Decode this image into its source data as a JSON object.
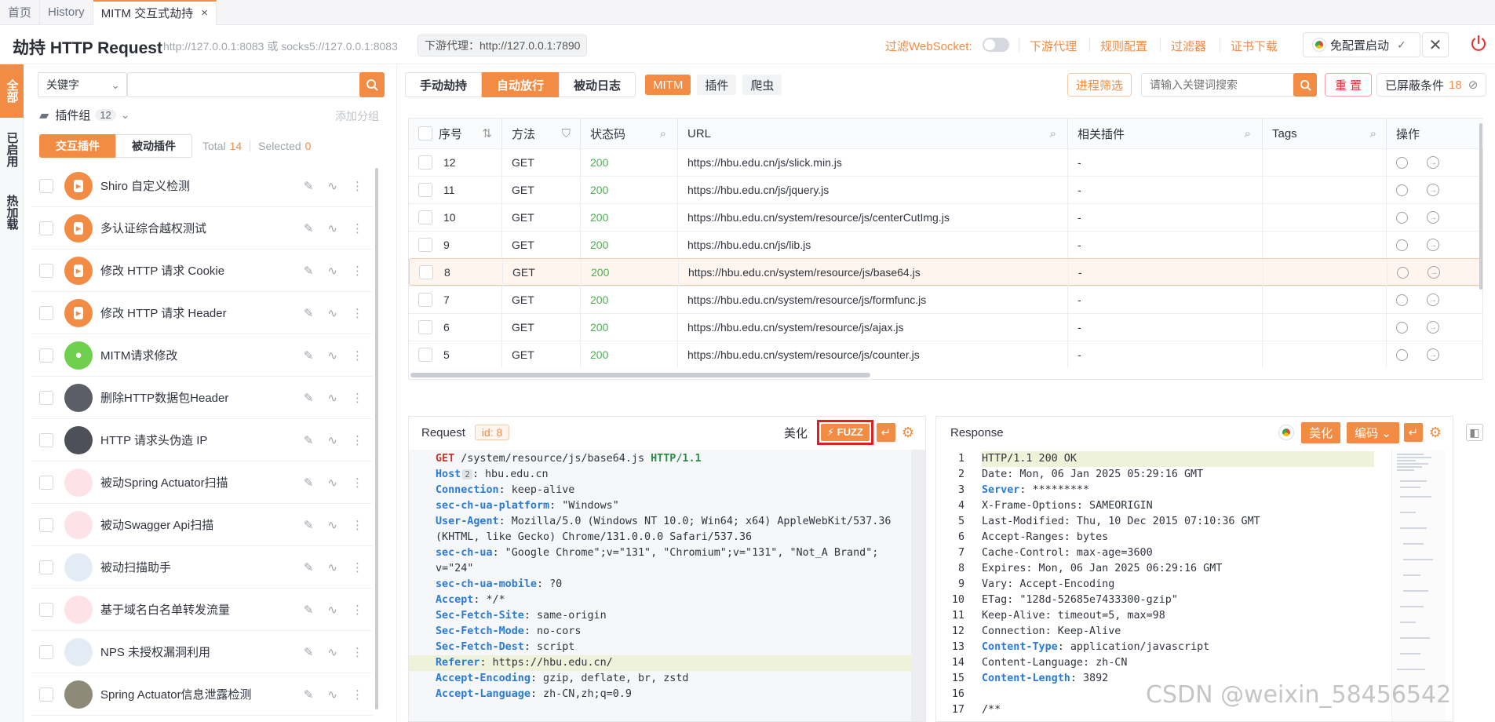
{
  "tabs": [
    {
      "label": "首页"
    },
    {
      "label": "History"
    },
    {
      "label": "MITM 交互式劫持",
      "close": "×"
    }
  ],
  "header": {
    "title": "劫持 HTTP Request",
    "listen": "http://127.0.0.1:8083 或 socks5://127.0.0.1:8083",
    "downstream": "下游代理：http://127.0.0.1:7890",
    "filter_ws": "过滤WebSocket:",
    "links": [
      "下游代理",
      "规则配置",
      "过滤器",
      "证书下载"
    ],
    "launch": "免配置启动"
  },
  "vtabs": [
    "全部",
    "已启用",
    "热加载"
  ],
  "left": {
    "keyword_select": "关键字",
    "plugin_group": "插件组",
    "plugin_group_count": "12",
    "add_group": "添加分组",
    "seg": [
      "交互插件",
      "被动插件"
    ],
    "total_label": "Total",
    "total": "14",
    "selected_label": "Selected",
    "selected": "0",
    "plugins": [
      "Shiro 自定义检测",
      "多认证综合越权测试",
      "修改 HTTP 请求 Cookie",
      "修改 HTTP 请求 Header",
      "MITM请求修改",
      "删除HTTP数据包Header",
      "HTTP 请求头伪造 IP",
      "被动Spring Actuator扫描",
      "被动Swagger Api扫描",
      "被动扫描助手",
      "基于域名白名单转发流量",
      "NPS 未授权漏洞利用",
      "Spring Actuator信息泄露检测"
    ]
  },
  "toolbar": {
    "modes": [
      "手动劫持",
      "自动放行",
      "被动日志"
    ],
    "tags": [
      "MITM",
      "插件",
      "爬虫"
    ],
    "process_filter": "进程筛选",
    "search_placeholder": "请输入关键词搜索",
    "reset": "重 置",
    "blocked": "已屏蔽条件",
    "blocked_count": "18"
  },
  "table": {
    "headers": [
      "序号",
      "方法",
      "状态码",
      "URL",
      "相关插件",
      "Tags",
      "操作"
    ],
    "rows": [
      {
        "id": "12",
        "method": "GET",
        "status": "200",
        "url": "https://hbu.edu.cn/js/slick.min.js",
        "plugin": "-"
      },
      {
        "id": "11",
        "method": "GET",
        "status": "200",
        "url": "https://hbu.edu.cn/js/jquery.js",
        "plugin": "-"
      },
      {
        "id": "10",
        "method": "GET",
        "status": "200",
        "url": "https://hbu.edu.cn/system/resource/js/centerCutImg.js",
        "plugin": "-"
      },
      {
        "id": "9",
        "method": "GET",
        "status": "200",
        "url": "https://hbu.edu.cn/js/lib.js",
        "plugin": "-"
      },
      {
        "id": "8",
        "method": "GET",
        "status": "200",
        "url": "https://hbu.edu.cn/system/resource/js/base64.js",
        "plugin": "-"
      },
      {
        "id": "7",
        "method": "GET",
        "status": "200",
        "url": "https://hbu.edu.cn/system/resource/js/formfunc.js",
        "plugin": "-"
      },
      {
        "id": "6",
        "method": "GET",
        "status": "200",
        "url": "https://hbu.edu.cn/system/resource/js/ajax.js",
        "plugin": "-"
      },
      {
        "id": "5",
        "method": "GET",
        "status": "200",
        "url": "https://hbu.edu.cn/system/resource/js/counter.js",
        "plugin": "-"
      }
    ]
  },
  "request": {
    "title": "Request",
    "id": "id: 8",
    "beautify": "美化",
    "fuzz": "FUZZ",
    "host_badge": "2",
    "lines": [
      {
        "k": "GET",
        "v": " /system/resource/js/base64.js ",
        "k2": "HTTP/1.1"
      },
      {
        "k": "Host",
        "v": ": hbu.edu.cn"
      },
      {
        "k": "Connection",
        "v": ": keep-alive"
      },
      {
        "k": "sec-ch-ua-platform",
        "v": ": \"Windows\""
      },
      {
        "k": "User-Agent",
        "v": ": Mozilla/5.0 (Windows NT 10.0; Win64; x64) AppleWebKit/537.36"
      },
      {
        "k": "",
        "v": "(KHTML, like Gecko) Chrome/131.0.0.0 Safari/537.36"
      },
      {
        "k": "sec-ch-ua",
        "v": ": \"Google Chrome\";v=\"131\", \"Chromium\";v=\"131\", \"Not_A Brand\";"
      },
      {
        "k": "",
        "v": "v=\"24\""
      },
      {
        "k": "sec-ch-ua-mobile",
        "v": ": ?0"
      },
      {
        "k": "Accept",
        "v": ": */*"
      },
      {
        "k": "Sec-Fetch-Site",
        "v": ": same-origin"
      },
      {
        "k": "Sec-Fetch-Mode",
        "v": ": no-cors"
      },
      {
        "k": "Sec-Fetch-Dest",
        "v": ": script"
      },
      {
        "k": "Referer",
        "v": ": https://hbu.edu.cn/"
      },
      {
        "k": "Accept-Encoding",
        "v": ": gzip, deflate, br, zstd"
      },
      {
        "k": "Accept-Language",
        "v": ": zh-CN,zh;q=0.9"
      }
    ]
  },
  "response": {
    "title": "Response",
    "beautify": "美化",
    "encoding": "编码",
    "lines": [
      {
        "n": "1",
        "k": "",
        "v": "HTTP/1.1 200 OK"
      },
      {
        "n": "2",
        "k": "",
        "v": "Date: Mon, 06 Jan 2025 05:29:16 GMT"
      },
      {
        "n": "3",
        "k": "Server",
        "v": ": *********"
      },
      {
        "n": "4",
        "k": "",
        "v": "X-Frame-Options: SAMEORIGIN"
      },
      {
        "n": "5",
        "k": "",
        "v": "Last-Modified: Thu, 10 Dec 2015 07:10:36 GMT"
      },
      {
        "n": "6",
        "k": "",
        "v": "Accept-Ranges: bytes"
      },
      {
        "n": "7",
        "k": "",
        "v": "Cache-Control: max-age=3600"
      },
      {
        "n": "8",
        "k": "",
        "v": "Expires: Mon, 06 Jan 2025 06:29:16 GMT"
      },
      {
        "n": "9",
        "k": "",
        "v": "Vary: Accept-Encoding"
      },
      {
        "n": "10",
        "k": "",
        "v": "ETag: \"128d-52685e7433300-gzip\""
      },
      {
        "n": "11",
        "k": "",
        "v": "Keep-Alive: timeout=5, max=98"
      },
      {
        "n": "12",
        "k": "",
        "v": "Connection: Keep-Alive"
      },
      {
        "n": "13",
        "k": "Content-Type",
        "v": ": application/javascript"
      },
      {
        "n": "14",
        "k": "",
        "v": "Content-Language: zh-CN"
      },
      {
        "n": "15",
        "k": "Content-Length",
        "v": ": 3892"
      },
      {
        "n": "16",
        "k": "",
        "v": ""
      },
      {
        "n": "17",
        "k": "",
        "v": "/**"
      }
    ]
  },
  "watermark": "CSDN @weixin_58456542"
}
